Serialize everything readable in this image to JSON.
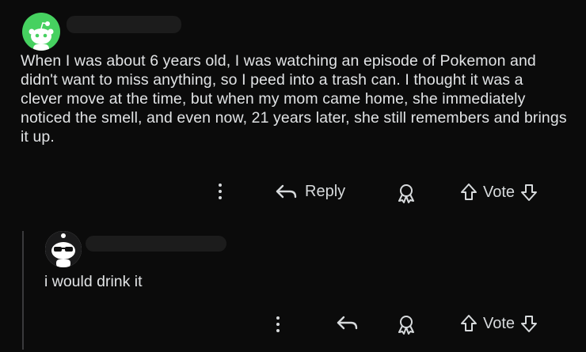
{
  "comment": {
    "avatar_icon": "snoo-avatar-icon",
    "avatar_color": "#46d160",
    "username_redacted": true,
    "body": "When I was about 6 years old, I was watching an episode of Pokemon and didn't want to miss anything, so I peed into a trash can. I thought it was a clever move at the time, but when my mom came home, she immediately noticed the smell, and even now, 21 years later, she still remembers and brings it up.",
    "actions": {
      "more_icon": "more-vertical-icon",
      "reply_label": "Reply",
      "award_icon": "award-icon",
      "vote_label": "Vote"
    }
  },
  "reply": {
    "avatar_icon": "snoo-sunglasses-avatar-icon",
    "username_redacted": true,
    "body": "i would drink it",
    "actions": {
      "more_icon": "more-vertical-icon",
      "reply_icon": "reply-arrow-icon",
      "award_icon": "award-icon",
      "vote_label": "Vote"
    }
  }
}
